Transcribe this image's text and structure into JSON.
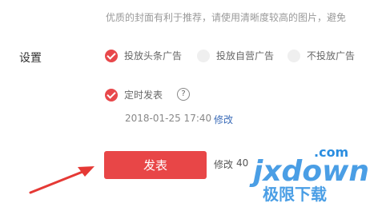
{
  "hint_text": "优质的封面有利于推荐，请使用清晰度较高的图片，避免",
  "settings": {
    "label": "设置",
    "ad_options": [
      {
        "label": "投放头条广告",
        "checked": true
      },
      {
        "label": "投放自营广告",
        "checked": false
      },
      {
        "label": "不投放广告",
        "checked": false
      }
    ],
    "scheduled": {
      "label": "定时发表",
      "checked": true,
      "help_icon": "?"
    },
    "datetime": "2018-01-25 17:40",
    "edit_label": "修改"
  },
  "actions": {
    "publish_label": "发表",
    "edit_label": "修改",
    "count": "40"
  },
  "watermark": {
    "top": ".com",
    "main": "jxdown",
    "cn": "极限下载"
  },
  "colors": {
    "accent": "#e84647",
    "link": "#3a6bb8",
    "watermark": "#2a8de0"
  }
}
